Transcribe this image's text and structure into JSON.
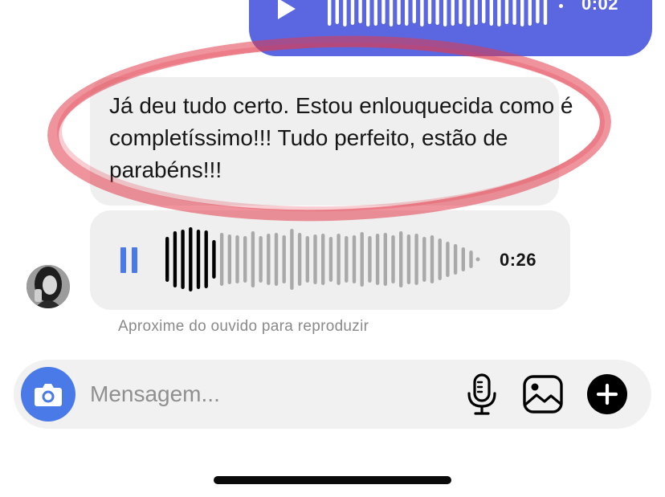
{
  "colors": {
    "outgoing_bubble": "#5b67e0",
    "incoming_bubble": "#efefef",
    "accent_blue": "#4a7ae8",
    "highlight_red": "#e23b4a",
    "wave_played": "#000000",
    "wave_unplayed": "#a9a9a9"
  },
  "outgoing_audio": {
    "icon": "play-icon",
    "duration": "0:02"
  },
  "incoming_message": {
    "text": "Já deu tudo certo. Estou enlouquecida como é completíssimo!!! Tudo perfeito, estão de parabéns!!!"
  },
  "incoming_audio": {
    "icon": "pause-icon",
    "duration": "0:26",
    "hint": "Aproxime do ouvido para reproduzir"
  },
  "composer": {
    "placeholder": "Mensagem...",
    "camera_icon": "camera-icon",
    "mic_icon": "microphone-icon",
    "gallery_icon": "gallery-icon",
    "add_icon": "plus-icon"
  }
}
